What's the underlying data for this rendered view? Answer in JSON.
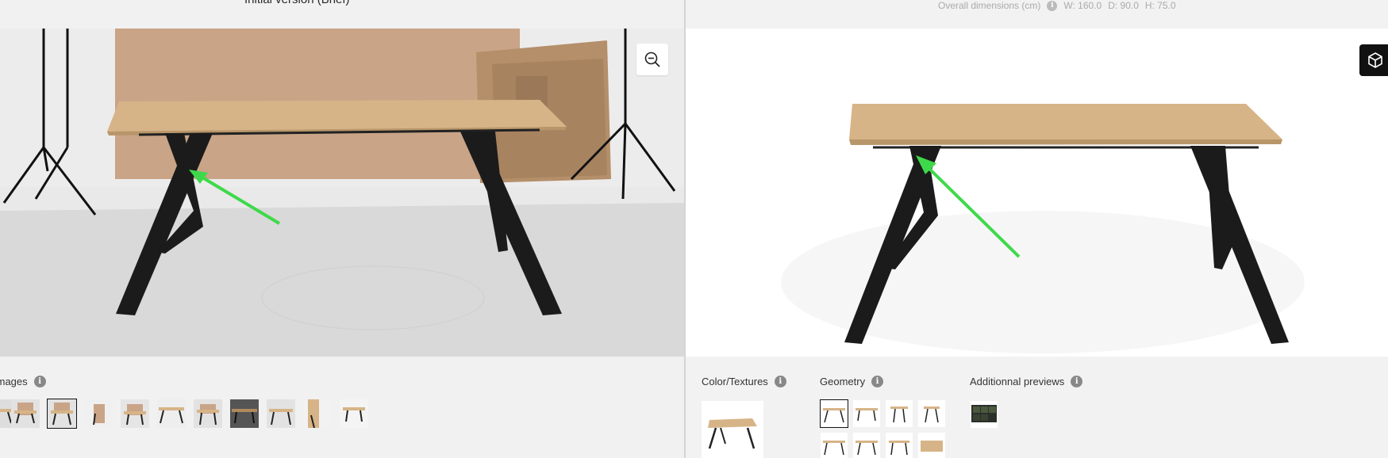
{
  "left": {
    "title_cut": "Initial version (Brief)",
    "images_label": "Images",
    "thumbnail_count": 11,
    "selected_thumbnail": 2
  },
  "right": {
    "dims_label": "Overall dimensions (cm)",
    "dims_w": "W: 160.0",
    "dims_d": "D: 90.0",
    "dims_h": "H: 75.0",
    "color_label": "Color/Textures",
    "geometry_label": "Geometry",
    "previews_label": "Additionnal previews"
  },
  "icons": {
    "zoom": "zoom-out-icon",
    "cube": "cube-3d-icon",
    "info": "info-icon",
    "arrow": "green-arrow-annotation"
  },
  "colors": {
    "arrow": "#3ed94a",
    "wood": "#d7b487",
    "legs": "#1b1b1b",
    "panel": "#f1f1f1"
  }
}
